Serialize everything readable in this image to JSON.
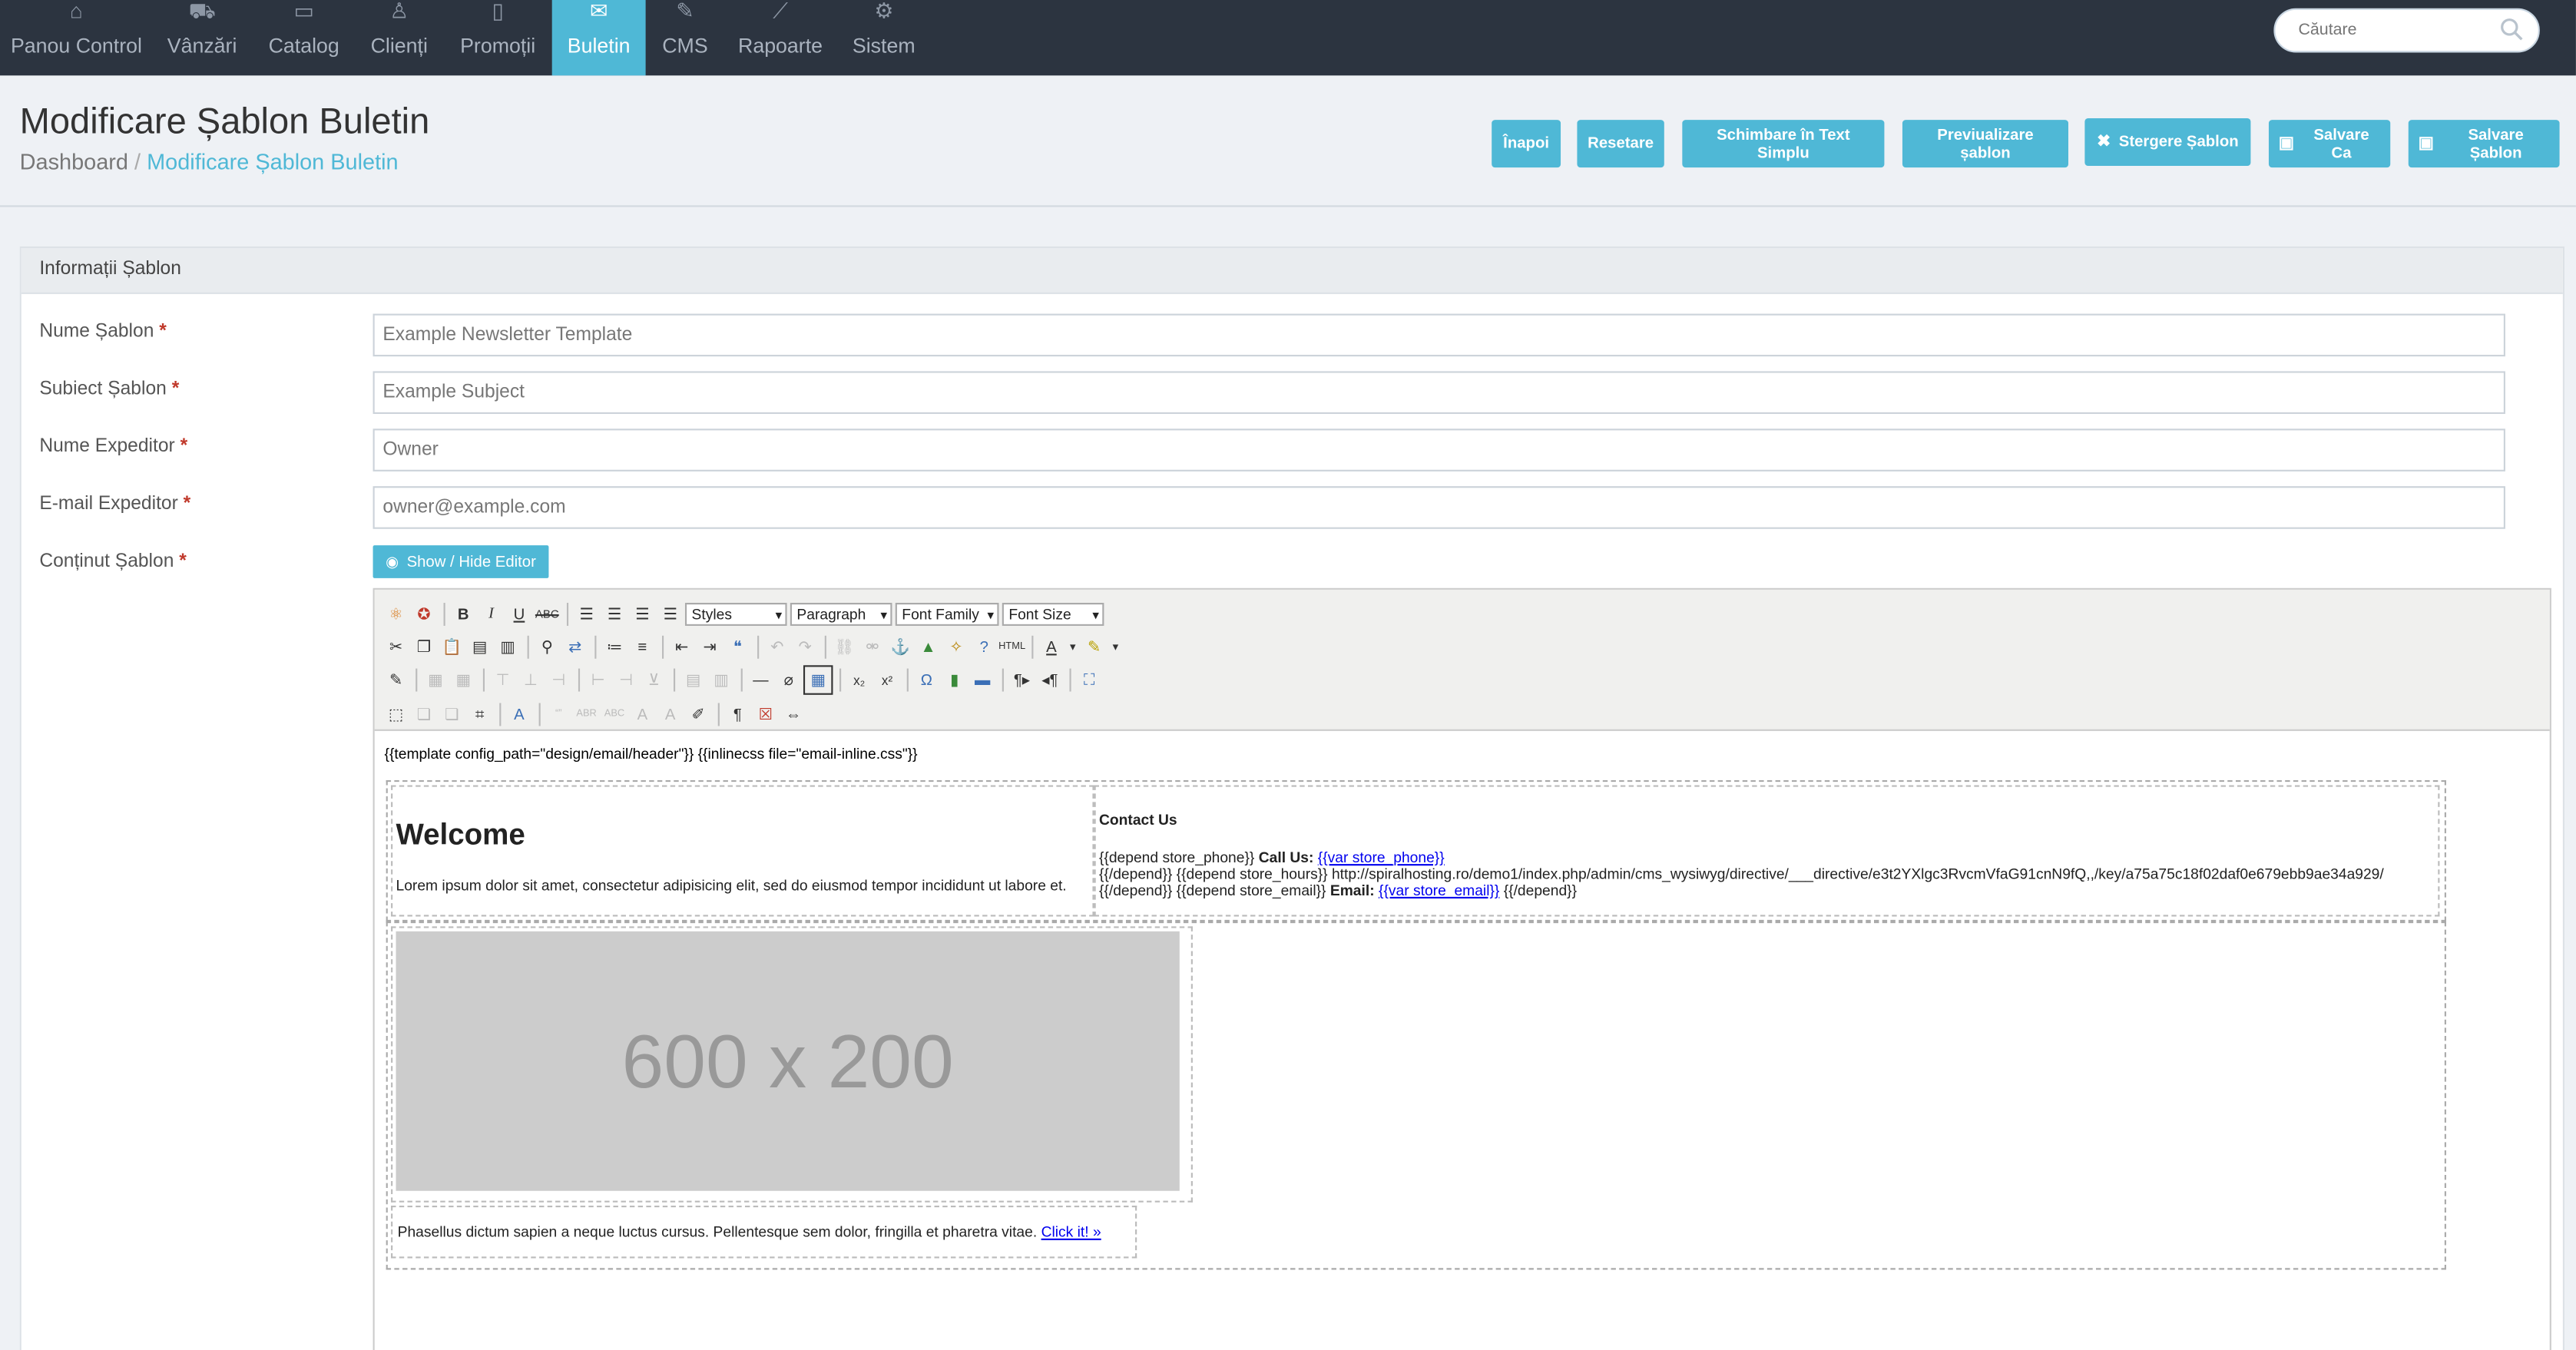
{
  "nav": {
    "items": [
      {
        "label": "Panou Control",
        "icon": "home-icon"
      },
      {
        "label": "Vânzări",
        "icon": "cart-icon"
      },
      {
        "label": "Catalog",
        "icon": "folder-icon"
      },
      {
        "label": "Clienți",
        "icon": "user-icon"
      },
      {
        "label": "Promoții",
        "icon": "bookmark-icon"
      },
      {
        "label": "Buletin",
        "icon": "envelope-icon",
        "active": true
      },
      {
        "label": "CMS",
        "icon": "edit-icon"
      },
      {
        "label": "Rapoarte",
        "icon": "chart-icon"
      },
      {
        "label": "Sistem",
        "icon": "gear-icon"
      }
    ],
    "search_placeholder": "Căutare"
  },
  "header": {
    "title": "Modificare Șablon Buletin",
    "breadcrumb": {
      "root": "Dashboard",
      "separator": "/",
      "current": "Modificare Șablon Buletin"
    },
    "buttons": {
      "back": "Înapoi",
      "reset": "Resetare",
      "to_plain": "Schimbare în Text Simplu",
      "preview": "Previualizare șablon",
      "delete": "Stergere Șablon",
      "save_as": "Salvare Ca",
      "save": "Salvare Șablon"
    }
  },
  "panel": {
    "title": "Informații Șablon",
    "fields": {
      "name": {
        "label": "Nume Șablon",
        "value": "Example Newsletter Template"
      },
      "subject": {
        "label": "Subiect Șablon",
        "value": "Example Subject"
      },
      "sender_name": {
        "label": "Nume Expeditor",
        "value": "Owner"
      },
      "sender_email": {
        "label": "E-mail Expeditor",
        "value": "owner@example.com"
      },
      "content": {
        "label": "Conținut Șablon"
      }
    },
    "required_mark": "*",
    "toggle_editor": "Show / Hide Editor"
  },
  "toolbar": {
    "styles": "Styles",
    "paragraph": "Paragraph",
    "font_family": "Font Family",
    "font_size": "Font Size"
  },
  "editor": {
    "template_line": "{{template config_path=\"design/email/header\"}} {{inlinecss file=\"email-inline.css\"}}",
    "welcome": "Welcome",
    "lorem": "Lorem ipsum dolor sit amet, consectetur adipisicing elit, sed do eiusmod tempor incididunt ut labore et.",
    "contact_title": "Contact Us",
    "line1_pre": "{{depend store_phone}}",
    "line1_bold": "Call Us:",
    "line1_link": "{{var store_phone}}",
    "line2": "{{/depend}} {{depend store_hours}} http://spiralhosting.ro/demo1/index.php/admin/cms_wysiwyg/directive/___directive/e3t2YXlgc3RvcmVfaG91cnN9fQ,,/key/a75a75c18f02daf0e679ebb9ae34a929/",
    "line3_pre": "{{/depend}} {{depend store_email}}",
    "line3_bold": "Email:",
    "line3_link": "{{var store_email}}",
    "line3_post": "{{/depend}}",
    "placeholder_text": "600 x 200",
    "phasellus": "Phasellus dictum sapien a neque luctus cursus. Pellentesque sem dolor, fringilla et pharetra vitae.",
    "click_link": "Click it! »"
  },
  "colors": {
    "accent": "#4fb8d6",
    "topbar": "#2c3440",
    "required": "#c0392b"
  }
}
